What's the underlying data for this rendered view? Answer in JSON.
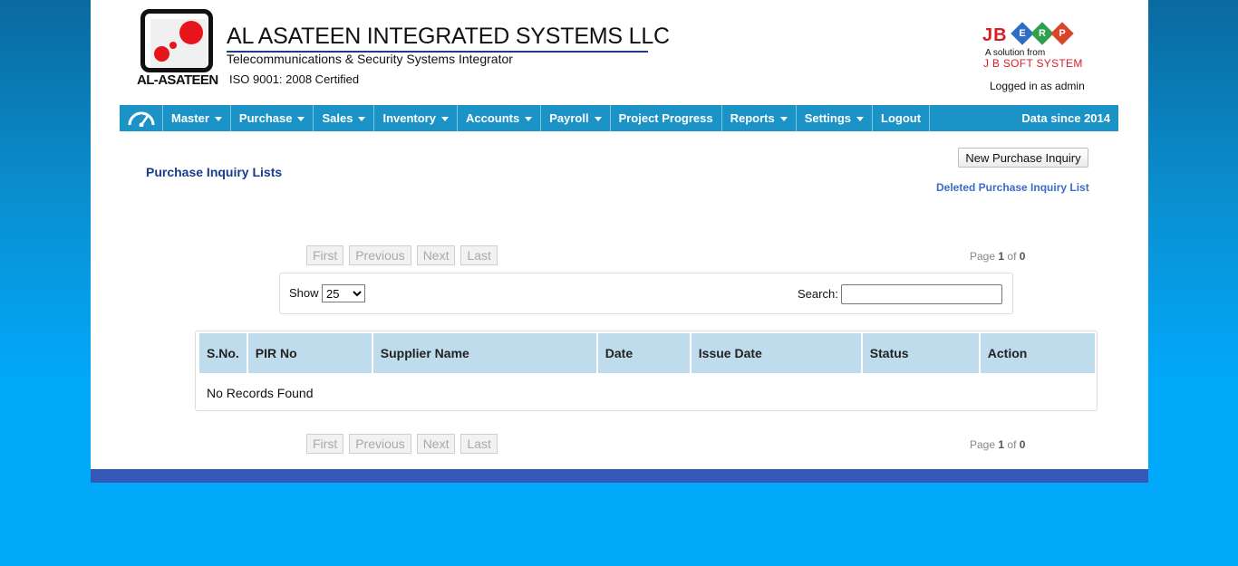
{
  "header": {
    "logo_text": "AL-ASATEEN",
    "company_name": "AL ASATEEN INTEGRATED SYSTEMS LLC",
    "company_subtitle": "Telecommunications & Security Systems Integrator",
    "company_iso": "ISO 9001: 2008 Certified",
    "erp_brand": {
      "jb": "JB",
      "letters": [
        "E",
        "R",
        "P"
      ],
      "solution": "A solution from",
      "system": "J B SOFT SYSTEM"
    },
    "logged_in": "Logged in as admin"
  },
  "nav": {
    "home_icon": "dashboard-gauge-icon",
    "items": [
      {
        "label": "Master",
        "dropdown": true
      },
      {
        "label": "Purchase",
        "dropdown": true
      },
      {
        "label": "Sales",
        "dropdown": true
      },
      {
        "label": "Inventory",
        "dropdown": true
      },
      {
        "label": "Accounts",
        "dropdown": true
      },
      {
        "label": "Payroll",
        "dropdown": true
      },
      {
        "label": "Project Progress",
        "dropdown": false
      },
      {
        "label": "Reports",
        "dropdown": true
      },
      {
        "label": "Settings",
        "dropdown": true
      },
      {
        "label": "Logout",
        "dropdown": false
      }
    ],
    "data_since": "Data since 2014"
  },
  "main": {
    "title": "Purchase Inquiry Lists",
    "new_button": "New Purchase Inquiry",
    "deleted_link": "Deleted Purchase Inquiry List",
    "pager": {
      "first": "First",
      "previous": "Previous",
      "next": "Next",
      "last": "Last",
      "page_label": "Page",
      "current": "1",
      "of_label": "of",
      "total": "0"
    },
    "show_label": "Show",
    "show_value": "25",
    "search_label": "Search:",
    "table": {
      "columns": [
        "S.No.",
        "PIR No",
        "Supplier Name",
        "Date",
        "Issue Date",
        "Status",
        "Action"
      ],
      "empty_message": "No Records Found"
    }
  },
  "colors": {
    "nav": "#1c93c7",
    "header_cell": "#bfdcec",
    "title": "#183c8c",
    "footer": "#3459b6",
    "background": "#02a8fa"
  }
}
